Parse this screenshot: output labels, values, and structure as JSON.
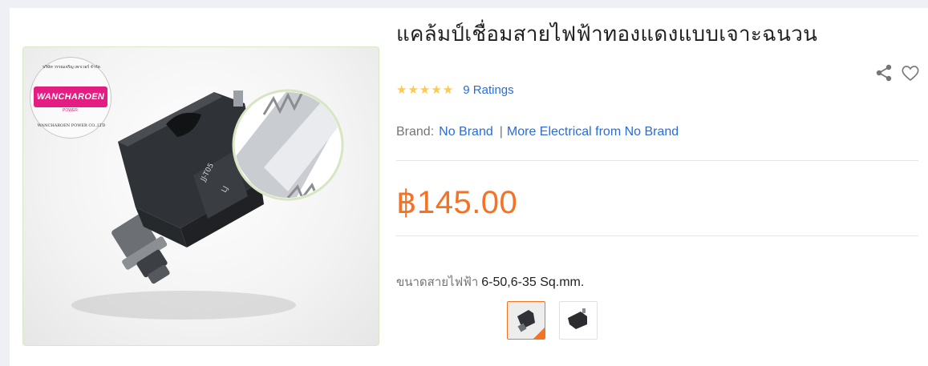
{
  "product": {
    "title": "แคล้มป์เชื่อมสายไฟฟ้าทองแดงแบบเจาะฉนวน",
    "ratings_text": "9 Ratings",
    "star_count": 5,
    "brand_label": "Brand:",
    "brand_name": "No Brand",
    "brand_separator": "|",
    "more_from_brand": "More Electrical from No Brand",
    "price": "฿145.00",
    "variant_label": "ขนาดสายไฟฟ้า",
    "variant_value": "6-50,6-35 Sq.mm."
  },
  "gallery": {
    "logo_text": "WANCHAROEN",
    "logo_sub": "POWER",
    "seal_text": "WANCHAROEN POWER CO.,LTD",
    "seal_thai": "บริษัท วรรณเจริญ เพาเวอร์ จำกัด",
    "device_marks": [
      "JJ-T05",
      "LJ"
    ]
  },
  "icons": {
    "share": "share-icon",
    "wishlist": "heart-icon",
    "star": "star-icon"
  },
  "colors": {
    "price": "#f57224",
    "link": "#2a6cd8",
    "star": "#faca51",
    "selected_border": "#f57224"
  }
}
